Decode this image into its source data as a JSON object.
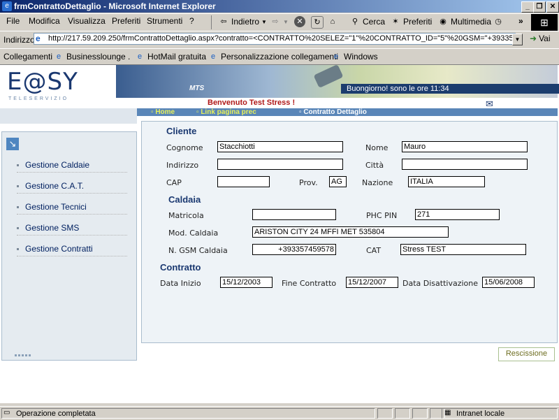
{
  "window": {
    "title": "frmContrattoDettaglio - Microsoft Internet Explorer"
  },
  "menu": [
    "File",
    "Modifica",
    "Visualizza",
    "Preferiti",
    "Strumenti",
    "?"
  ],
  "toolbar": {
    "back": "Indietro",
    "search": "Cerca",
    "favorites": "Preferiti",
    "media": "Multimedia"
  },
  "address": {
    "label": "Indirizzo",
    "url": "http://217.59.209.250/frmContrattoDettaglio.aspx?contratto=<CONTRATTO%20SELEZ=\"1\"%20CONTRATTO_ID=\"5\"%20GSM=\"+393357",
    "go": "Vai"
  },
  "links": {
    "label": "Collegamenti",
    "items": [
      "Businesslounge .",
      "HotMail gratuita",
      "Personalizzazione collegamenti",
      "Windows"
    ]
  },
  "header": {
    "logo": "E@SY",
    "logo_sub": "TELESERVIZIO",
    "brand": "MTS",
    "greeting": "Buongiorno! sono le ore 11:34",
    "welcome": "Benvenuto Test Stress !"
  },
  "nav": {
    "home": "Home",
    "back_link": "Link pagina prec",
    "current": "Contratto Dettaglio"
  },
  "sidebar": {
    "items": [
      "Gestione Caldaie",
      "Gestione C.A.T.",
      "Gestione Tecnici",
      "Gestione SMS",
      "Gestione Contratti"
    ]
  },
  "cliente": {
    "title": "Cliente",
    "cognome_label": "Cognome",
    "cognome": "Stacchiotti",
    "nome_label": "Nome",
    "nome": "Mauro",
    "indirizzo_label": "Indirizzo",
    "indirizzo": "",
    "citta_label": "Città",
    "citta": "",
    "cap_label": "CAP",
    "cap": "",
    "prov_label": "Prov.",
    "prov": "AG",
    "nazione_label": "Nazione",
    "nazione": "ITALIA"
  },
  "caldaia": {
    "title": "Caldaia",
    "matricola_label": "Matricola",
    "matricola": "",
    "phc_label": "PHC PIN",
    "phc": "271",
    "mod_label": "Mod. Caldaia",
    "mod": "ARISTON CITY 24 MFFI MET 535804",
    "gsm_label": "N. GSM Caldaia",
    "gsm": "+393357459578",
    "cat_label": "CAT",
    "cat": "Stress TEST"
  },
  "contratto": {
    "title": "Contratto",
    "inizio_label": "Data Inizio",
    "inizio": "15/12/2003",
    "fine_label": "Fine Contratto",
    "fine": "15/12/2007",
    "disatt_label": "Data Disattivazione",
    "disatt": "15/06/2008"
  },
  "actions": {
    "rescissione": "Rescissione"
  },
  "status": {
    "text": "Operazione completata",
    "zone": "Intranet locale"
  }
}
